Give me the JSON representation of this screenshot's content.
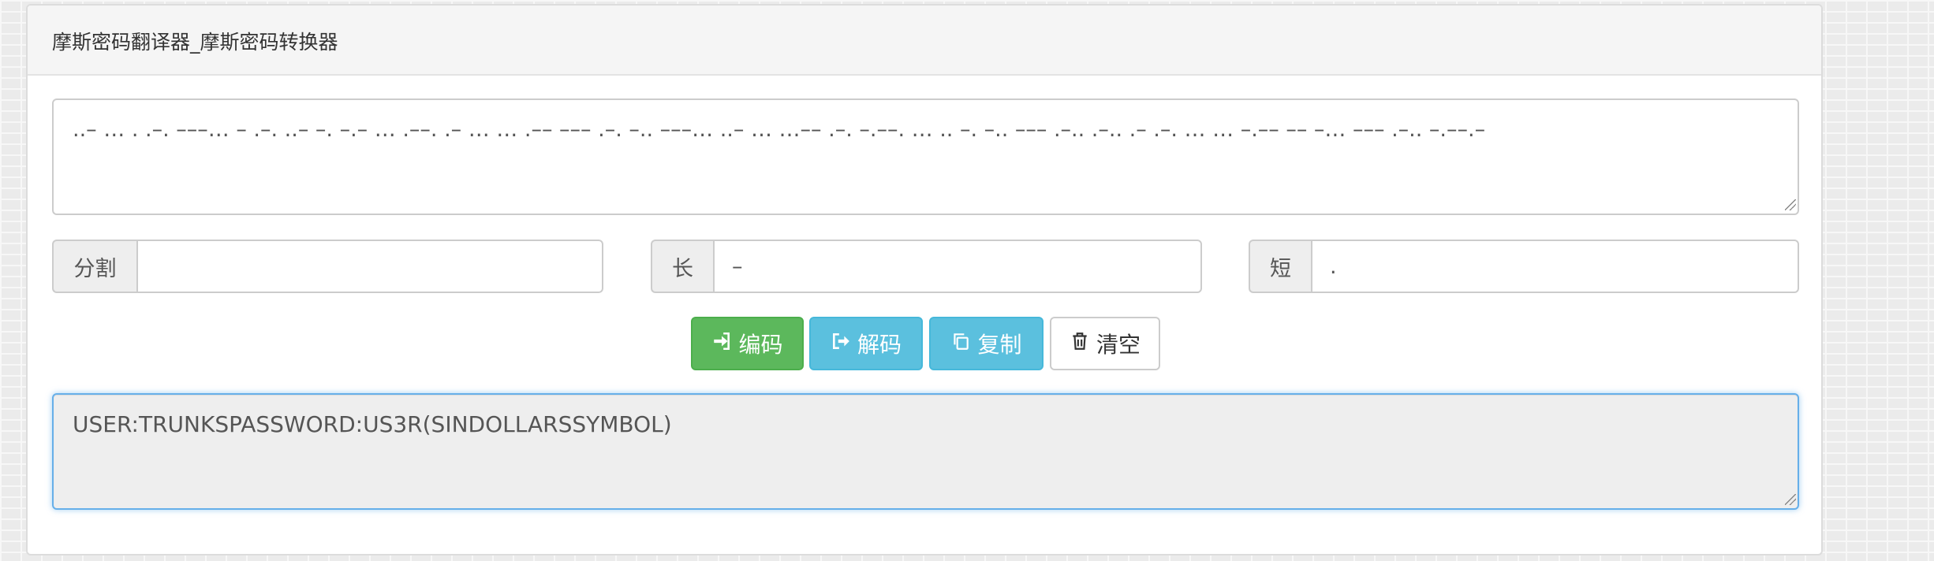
{
  "panel": {
    "title": "摩斯密码翻译器_摩斯密码转换器"
  },
  "morse_input": {
    "value": "..– … . .–. –––… – .–. ..– –. –.– … .––. .– … … .–– ––– .–. –.. –––… ..– … …–– .–. –.––. … .. –. –.. ––– .–.. .–.. .– .–. … … –.–– –– –… ––– .–.. –.––.–"
  },
  "options": {
    "separator": {
      "label": "分割",
      "value": ""
    },
    "long": {
      "label": "长",
      "value": "–"
    },
    "short": {
      "label": "短",
      "value": "."
    }
  },
  "buttons": {
    "encode": {
      "label": "编码",
      "icon": "sign-in-icon"
    },
    "decode": {
      "label": "解码",
      "icon": "share-icon"
    },
    "copy": {
      "label": "复制",
      "icon": "copy-icon"
    },
    "clear": {
      "label": "清空",
      "icon": "trash-icon"
    }
  },
  "result": {
    "value": "USER:TRUNKSPASSWORD:US3R(SINDOLLARSSYMBOL)"
  },
  "colors": {
    "success": "#5cb85c",
    "info": "#5bc0de",
    "focus": "#66afe9"
  }
}
